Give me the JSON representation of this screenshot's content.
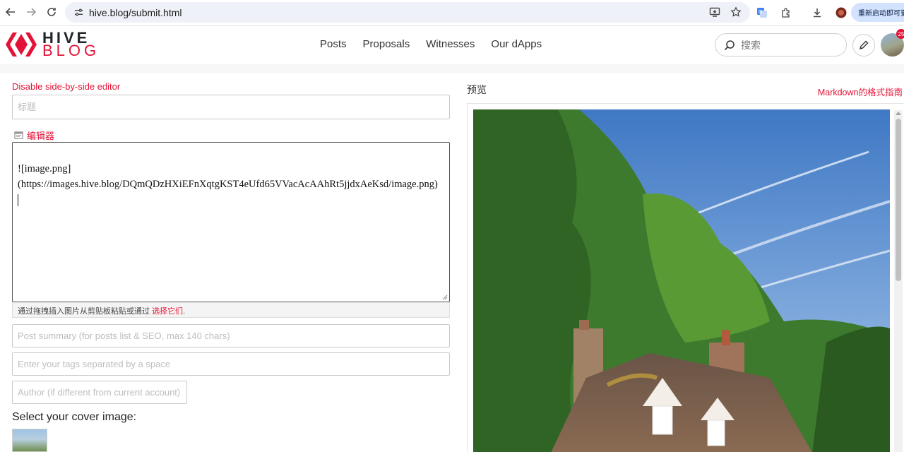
{
  "browser": {
    "url": "hive.blog/submit.html",
    "restart_label": "重新启动即可更新"
  },
  "header": {
    "logo_line1": "HIVE",
    "logo_line2": "BLOG",
    "nav": [
      "Posts",
      "Proposals",
      "Witnesses",
      "Our dApps"
    ],
    "search_placeholder": "搜索",
    "notification_count": "25"
  },
  "editor": {
    "toggle_label": "Disable side-by-side editor",
    "title_placeholder": "标题",
    "editor_label": "编辑器",
    "body_line1": "![image.png]",
    "body_line2": "(https://images.hive.blog/DQmQDzHXiEFnXqtgKST4eUfd65VVacAcAAhRt5jjdxAeKsd/image.png)",
    "upload_hint": "通过拖拽插入图片从剪贴板粘贴或通过",
    "upload_link": "选择它们",
    "upload_end": ".",
    "summary_placeholder": "Post summary (for posts list & SEO, max 140 chars)",
    "tags_placeholder": "Enter your tags separated by a space",
    "author_placeholder": "Author (if different from current account)",
    "cover_heading": "Select your cover image:"
  },
  "preview": {
    "label": "预览",
    "markdown_guide": "Markdown的格式指南"
  },
  "colors": {
    "brand_red": "#e31337",
    "omnibox_bg": "#eef1f8"
  }
}
